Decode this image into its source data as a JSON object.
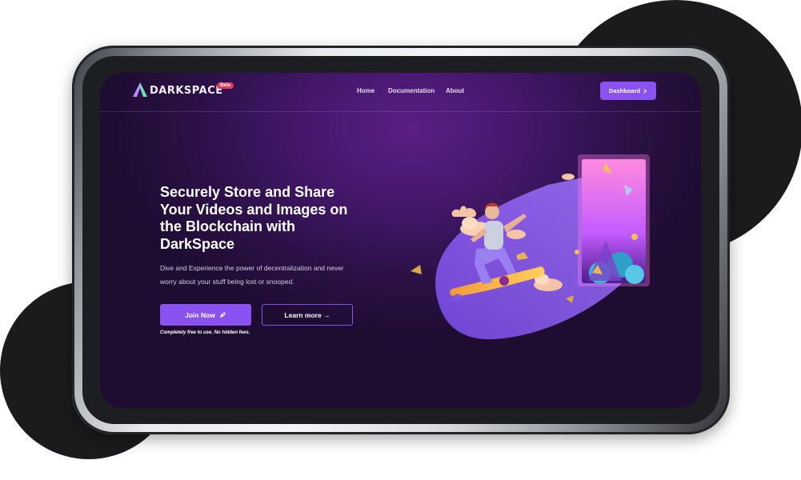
{
  "brand": {
    "name": "DARKSPACE",
    "badge": "Beta"
  },
  "nav": {
    "links": [
      "Home",
      "Documentation",
      "About"
    ],
    "dashboard_label": "Dashboard",
    "dashboard_icon": "chevron-right-icon"
  },
  "hero": {
    "headline": "Securely Store and Share Your Videos and Images on the Blockchain with DarkSpace",
    "subtext": "Dive and Experience the power of decentralization and never worry about your stuff being lost or snooped.",
    "join_label": "Join Now",
    "join_icon": "rocket-icon",
    "learn_label": "Learn more →",
    "note": "Completely free to use. No hidden fees."
  },
  "colors": {
    "accent": "#8a52f0",
    "badge": "#e33a5a",
    "background": "#2c1147"
  }
}
